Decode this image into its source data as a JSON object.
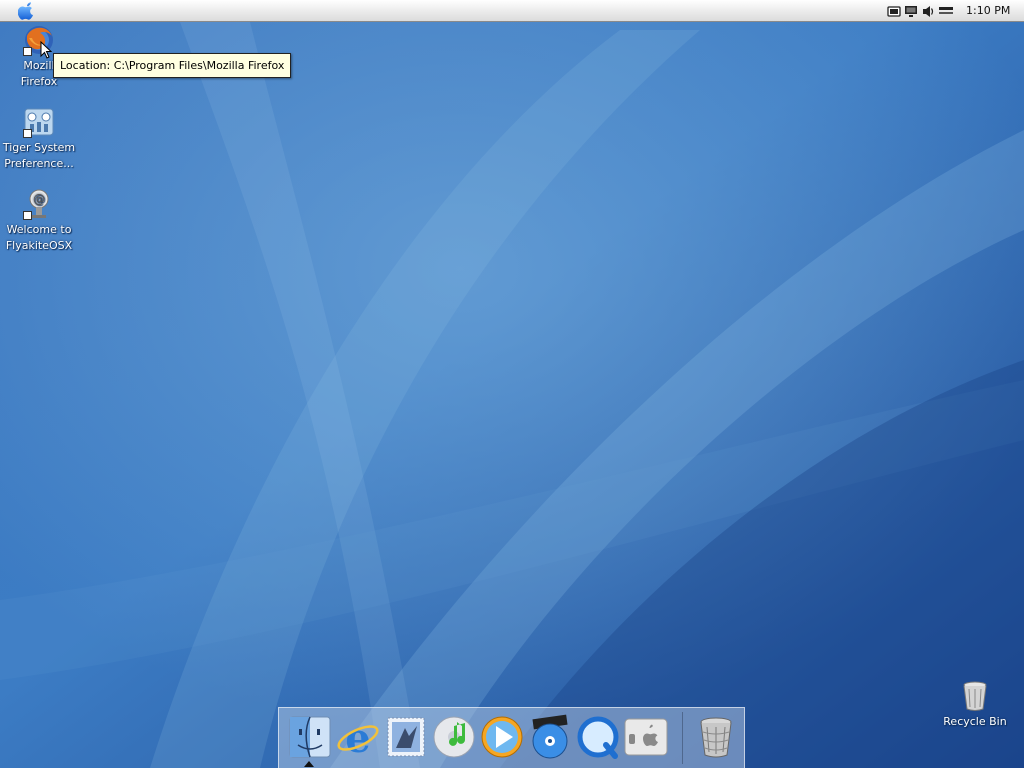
{
  "menubar": {
    "clock": "1:10 PM",
    "tray_icons": [
      "window-icon",
      "monitor-icon",
      "volume-icon",
      "battery-icon"
    ]
  },
  "desktop": {
    "icons": [
      {
        "name": "firefox-shortcut",
        "label": "Mozilla\nFirefox",
        "visible_label": "Mozill\nFirefox",
        "icon": "firefox-icon"
      },
      {
        "name": "tiger-system-preferences-shortcut",
        "label": "Tiger System\nPreference...",
        "icon": "system-preferences-icon"
      },
      {
        "name": "welcome-flyakite-shortcut",
        "label": "Welcome to\nFlyakiteOSX",
        "icon": "welcome-icon"
      },
      {
        "name": "recycle-bin",
        "label": "Recycle Bin",
        "icon": "trash-icon"
      }
    ]
  },
  "tooltip": {
    "text": "Location: C:\\Program Files\\Mozilla Firefox"
  },
  "dock": {
    "items": [
      {
        "name": "finder",
        "icon": "finder-icon"
      },
      {
        "name": "internet-explorer",
        "icon": "internet-explorer-icon"
      },
      {
        "name": "mail",
        "icon": "mail-stamp-icon"
      },
      {
        "name": "itunes",
        "icon": "itunes-icon"
      },
      {
        "name": "media-player",
        "icon": "play-icon"
      },
      {
        "name": "dvd-player",
        "icon": "dvd-icon"
      },
      {
        "name": "quicktime",
        "icon": "quicktime-icon"
      },
      {
        "name": "system-toggle",
        "icon": "apple-switch-icon"
      },
      {
        "name": "trash",
        "icon": "trash-icon"
      }
    ]
  },
  "colors": {
    "wallpaper_dark": "#1c4a92",
    "wallpaper_light": "#6fa6d6",
    "tooltip_bg": "#ffffe1"
  }
}
